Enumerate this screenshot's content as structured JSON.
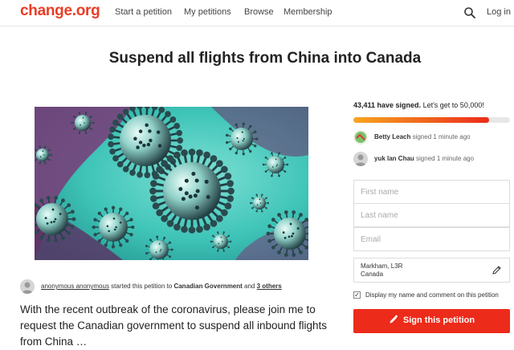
{
  "header": {
    "logo": "change.org",
    "nav": [
      "Start a petition",
      "My petitions",
      "Browse",
      "Membership"
    ],
    "search_icon": "search-icon",
    "login": "Log in"
  },
  "petition": {
    "title": "Suspend all flights from China into Canada",
    "image": "coronavirus-illustration",
    "starter": {
      "name": "anonymous anonymous",
      "action": " started this petition to ",
      "target": "Canadian Government",
      "and": " and ",
      "others": "3 others"
    },
    "body": "With the recent outbreak of the coronavirus, please join me to request the Canadian government to suspend all inbound flights from China …"
  },
  "sidebar": {
    "signed_count": "43,411 have signed.",
    "goal_text": " Let's get to 50,000!",
    "progress": 0.868,
    "recent_signers": [
      {
        "name": "Betty Leach",
        "time": " signed 1 minute ago"
      },
      {
        "name": "yuk lan Chau",
        "time": " signed 1 minute ago"
      }
    ],
    "form": {
      "first_name_placeholder": "First name",
      "last_name_placeholder": "Last name",
      "email_placeholder": "Email",
      "location_line1": "Markham, L3R",
      "location_line2": "Canada",
      "display_checkbox_label": "Display my name and comment on this petition",
      "display_checked": true,
      "sign_button": "Sign this petition"
    }
  },
  "colors": {
    "brand_red": "#ec2b1b",
    "progress_start": "#f7a51f",
    "image_teal": "#3fc4b8",
    "image_purple": "#7a3a78"
  }
}
